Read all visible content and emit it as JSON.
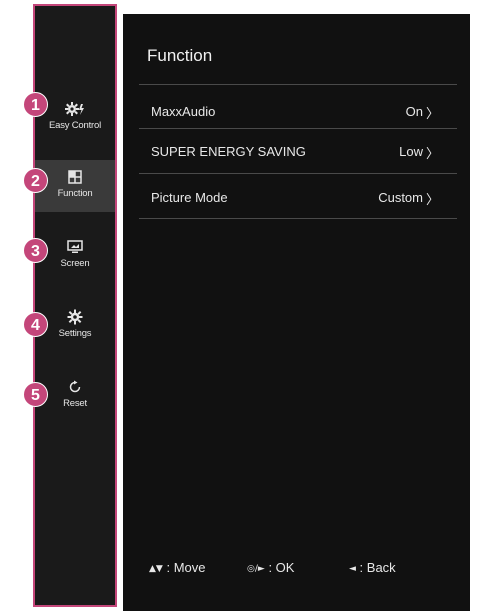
{
  "sidebar": {
    "items": [
      {
        "label": "Easy Control",
        "icon": "easy-control-gear-icon",
        "badge": "1"
      },
      {
        "label": "Function",
        "icon": "function-grid-icon",
        "badge": "2",
        "active": true
      },
      {
        "label": "Screen",
        "icon": "screen-monitor-icon",
        "badge": "3"
      },
      {
        "label": "Settings",
        "icon": "gear-icon",
        "badge": "4"
      },
      {
        "label": "Reset",
        "icon": "reset-icon",
        "badge": "5"
      }
    ]
  },
  "panel": {
    "title": "Function",
    "rows": [
      {
        "name": "MaxxAudio",
        "value": "On"
      },
      {
        "name": "SUPER ENERGY SAVING",
        "value": "Low"
      },
      {
        "name": "Picture Mode",
        "value": "Custom"
      }
    ],
    "chevron": "〉"
  },
  "footer": {
    "move_symbols": "▲▼",
    "move_label": ": Move",
    "ok_symbols": "◎/►",
    "ok_label": ": OK",
    "back_symbol": "◄",
    "back_label": ": Back"
  },
  "colors": {
    "accent": "#c4467a",
    "sidebar_bg": "#1a1a1a",
    "panel_bg": "#111111",
    "active_item_bg": "#3a3a3a",
    "text": "#e8e8e8"
  }
}
